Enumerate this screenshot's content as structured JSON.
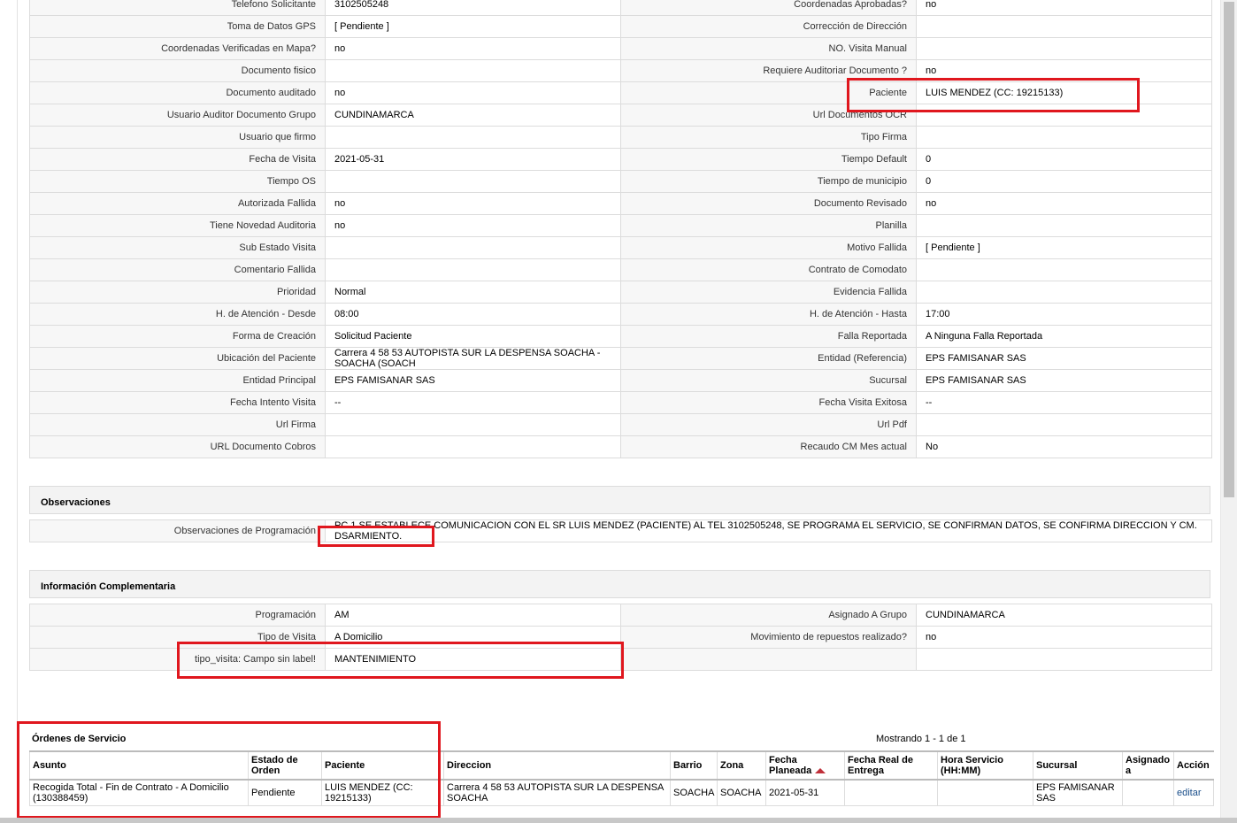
{
  "details": [
    [
      "Telefono Solicitante",
      "3102505248",
      "Coordenadas Aprobadas?",
      "no"
    ],
    [
      "Toma de Datos GPS",
      "[ Pendiente ]",
      "Corrección de Dirección",
      ""
    ],
    [
      "Coordenadas Verificadas en Mapa?",
      "no",
      "NO. Visita Manual",
      ""
    ],
    [
      "Documento fisico",
      "",
      "Requiere Auditoriar Documento ?",
      "no"
    ],
    [
      "Documento auditado",
      "no",
      "Paciente",
      "LUIS MENDEZ (CC: 19215133)"
    ],
    [
      "Usuario Auditor Documento Grupo",
      "CUNDINAMARCA",
      "Url Documentos OCR",
      ""
    ],
    [
      "Usuario que firmo",
      "",
      "Tipo Firma",
      ""
    ],
    [
      "Fecha de Visita",
      "2021-05-31",
      "Tiempo Default",
      "0"
    ],
    [
      "Tiempo OS",
      "",
      "Tiempo de municipio",
      "0"
    ],
    [
      "Autorizada Fallida",
      "no",
      "Documento Revisado",
      "no"
    ],
    [
      "Tiene Novedad Auditoria",
      "no",
      "Planilla",
      ""
    ],
    [
      "Sub Estado Visita",
      "",
      "Motivo Fallida",
      "[ Pendiente ]"
    ],
    [
      "Comentario Fallida",
      "",
      "Contrato de Comodato",
      ""
    ],
    [
      "Prioridad",
      "Normal",
      "Evidencia Fallida",
      ""
    ],
    [
      "H. de Atención - Desde",
      "08:00",
      "H. de Atención - Hasta",
      "17:00"
    ],
    [
      "Forma de Creación",
      "Solicitud Paciente",
      "Falla Reportada",
      "A Ninguna Falla Reportada"
    ],
    [
      "Ubicación del Paciente",
      "Carrera 4 58 53 AUTOPISTA SUR LA DESPENSA SOACHA - SOACHA (SOACH",
      "Entidad (Referencia)",
      "EPS FAMISANAR SAS"
    ],
    [
      "Entidad Principal",
      "EPS FAMISANAR SAS",
      "Sucursal",
      "EPS FAMISANAR SAS"
    ],
    [
      "Fecha Intento Visita",
      "--",
      "Fecha Visita Exitosa",
      "--"
    ],
    [
      "Url Firma",
      "",
      "Url Pdf",
      ""
    ],
    [
      "URL Documento Cobros",
      "",
      "Recaudo CM Mes actual",
      "No"
    ]
  ],
  "observaciones": {
    "title": "Observaciones",
    "label": "Observaciones de Programación",
    "value": "PC 1 SE ESTABLECE COMUNICACION CON EL SR LUIS MENDEZ (PACIENTE) AL TEL 3102505248, SE PROGRAMA EL SERVICIO, SE CONFIRMAN DATOS, SE CONFIRMA DIRECCION Y CM. DSARMIENTO."
  },
  "complementaria": {
    "title": "Información Complementaria",
    "rows": [
      [
        "Programación",
        "AM",
        "Asignado A Grupo",
        "CUNDINAMARCA"
      ],
      [
        "Tipo de Visita",
        "A Domicilio",
        "Movimiento de repuestos realizado?",
        "no"
      ],
      [
        "tipo_visita: Campo sin label!",
        "MANTENIMIENTO",
        "",
        ""
      ]
    ]
  },
  "ordenes": {
    "title": "Órdenes de Servicio",
    "showing": "Mostrando 1 - 1 de 1",
    "headers": [
      "Asunto",
      "Estado de Orden",
      "Paciente",
      "Direccion",
      "Barrio",
      "Zona",
      "Fecha Planeada",
      "Fecha Real de Entrega",
      "Hora Servicio (HH:MM)",
      "Sucursal",
      "Asignado a",
      "Acción"
    ],
    "row": [
      "Recogida Total - Fin de Contrato - A Domicilio (130388459)",
      "Pendiente",
      "LUIS MENDEZ (CC: 19215133)",
      "Carrera 4 58 53 AUTOPISTA SUR LA DESPENSA SOACHA",
      "SOACHA",
      "SOACHA",
      "2021-05-31",
      "",
      "",
      "EPS FAMISANAR SAS",
      "",
      "editar"
    ]
  },
  "colors": {
    "highlight": "#e0171e",
    "link": "#1a4e8a"
  }
}
